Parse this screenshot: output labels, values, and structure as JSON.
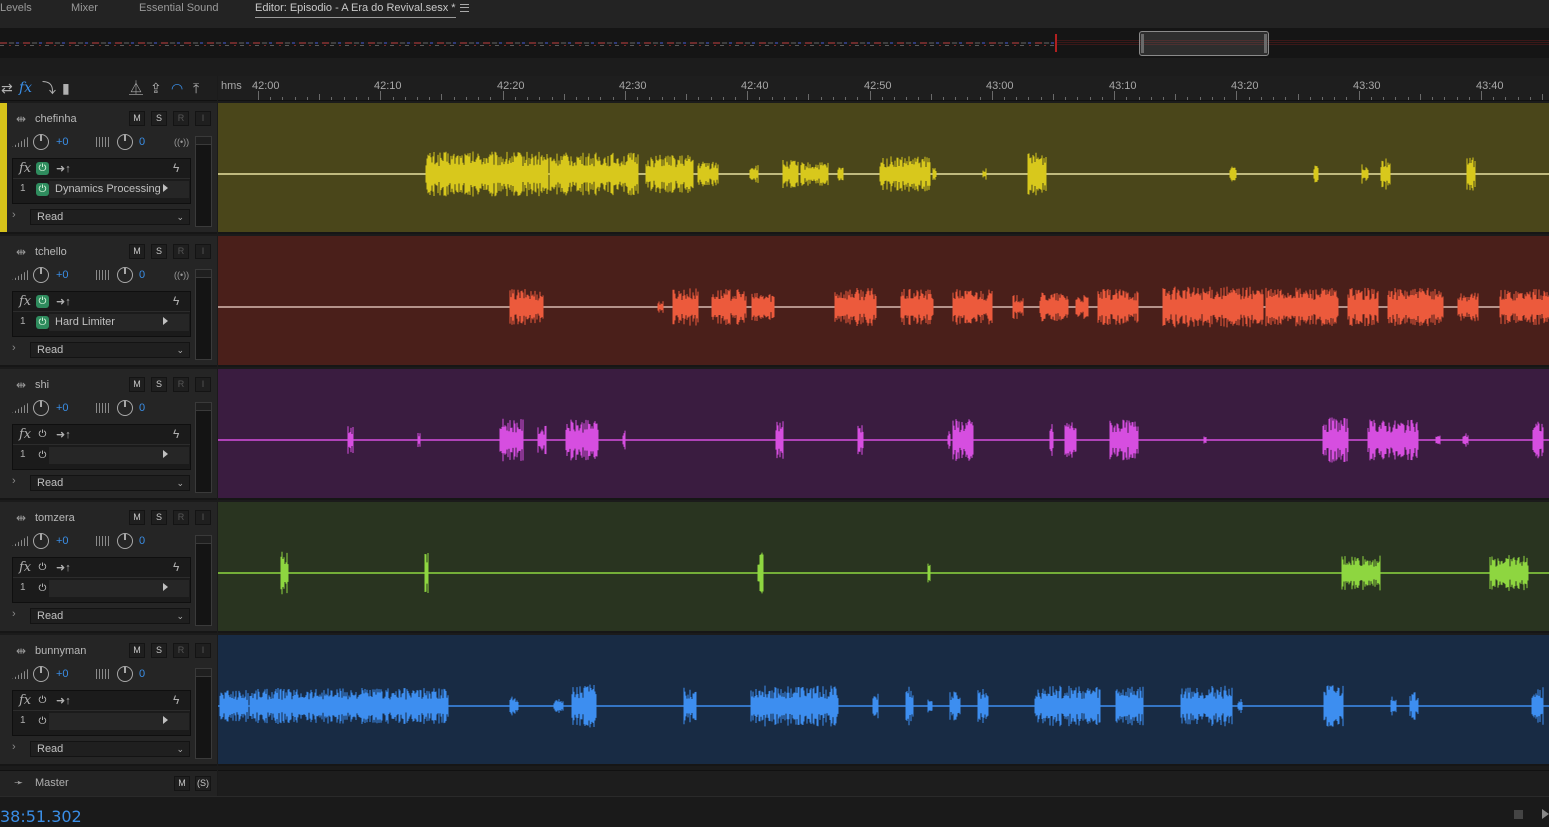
{
  "tabs": {
    "levels": "Levels",
    "mixer": "Mixer",
    "essential_sound": "Essential Sound",
    "editor": "Editor: Episodio - A Era do Revival.sesx *"
  },
  "ruler": {
    "unit": "hms",
    "labels": [
      "42:00",
      "42:10",
      "42:20",
      "42:30",
      "42:40",
      "42:50",
      "43:00",
      "43:10",
      "43:20",
      "43:30",
      "43:40"
    ]
  },
  "read_label": "Read",
  "tracks": [
    {
      "name": "chefinha",
      "volume": "+0",
      "pan": "0",
      "fx_slot": "1",
      "effect": "Dynamics Processing",
      "fx_on": true,
      "color": "#d8c81c",
      "bg": "#4a461a"
    },
    {
      "name": "tchello",
      "volume": "+0",
      "pan": "0",
      "fx_slot": "1",
      "effect": "Hard Limiter",
      "fx_on": true,
      "color": "#ec5a3c",
      "bg": "#4a1f1a"
    },
    {
      "name": "shi",
      "volume": "+0",
      "pan": "0",
      "fx_slot": "1",
      "effect": "",
      "fx_on": false,
      "color": "#d64ee0",
      "bg": "#3a1c40"
    },
    {
      "name": "tomzera",
      "volume": "+0",
      "pan": "0",
      "fx_slot": "1",
      "effect": "",
      "fx_on": false,
      "color": "#8ed640",
      "bg": "#293420"
    },
    {
      "name": "bunnyman",
      "volume": "+0",
      "pan": "0",
      "fx_slot": "1",
      "effect": "",
      "fx_on": false,
      "color": "#3d8ef0",
      "bg": "#182b44"
    }
  ],
  "master": {
    "name": "Master"
  },
  "status": {
    "time": "38:51.302"
  },
  "colors": {
    "accent": "#3a8ee6",
    "selected_track": "#d6c21a",
    "playhead_marker": "#b02020"
  }
}
